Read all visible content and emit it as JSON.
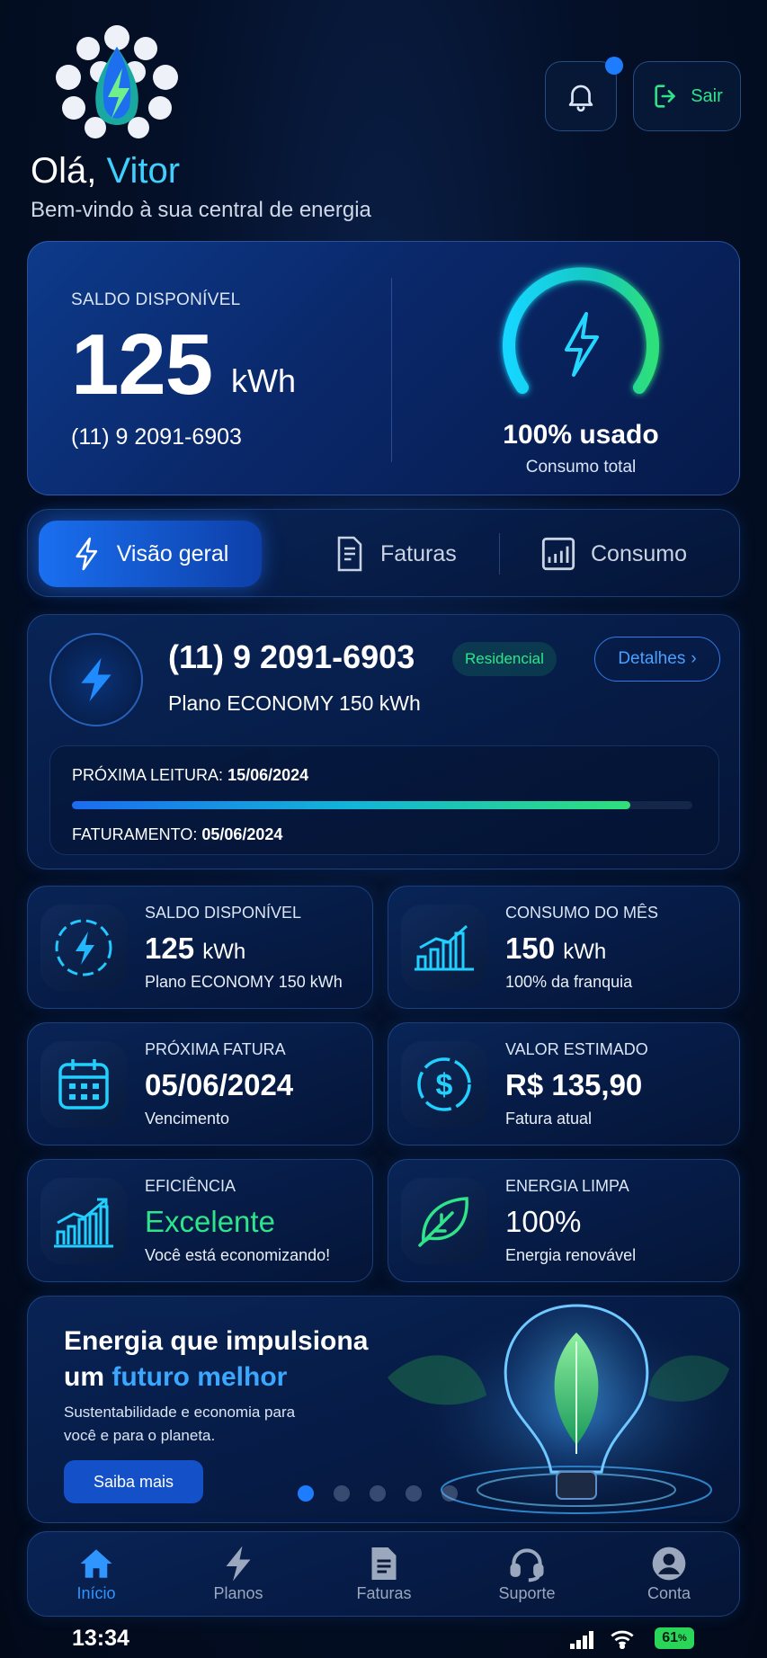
{
  "header": {
    "greeting": "Olá, ",
    "name": "Vitor",
    "welcome": "Bem-vindo à sua central de energia",
    "logout": "Sair",
    "notification_dot": true
  },
  "balance": {
    "label": "SALDO DISPONÍVEL",
    "value": "125",
    "unit": "kWh",
    "phone": "(11) 9 2091-6903",
    "usage_percent": 100,
    "usage_text": "100% usado",
    "usage_label": "Consumo total"
  },
  "tabs": [
    {
      "label": "Visão geral",
      "icon": "bolt-icon",
      "active": true
    },
    {
      "label": "Faturas",
      "icon": "invoice-icon"
    },
    {
      "label": "Consumo",
      "icon": "chart-icon"
    }
  ],
  "plan": {
    "phone": "(11) 9 2091-6903",
    "type": "Residencial",
    "details": "Detalhes",
    "name": "Plano ECONOMY 150 kWh",
    "next_reading_label": "PRÓXIMA LEITURA:",
    "next_reading": "15/06/2024",
    "billing_label": "FATURAMENTO:",
    "billing": "05/06/2024",
    "progress": 0.9
  },
  "stats": [
    {
      "title": "SALDO DISPONÍVEL",
      "value": "125",
      "unit": "kWh",
      "sub": "Plano ECONOMY 150 kWh",
      "icon": "bolt-circle-icon"
    },
    {
      "title": "CONSUMO DO MÊS",
      "value": "150",
      "unit": "kWh",
      "sub": "100% da franquia",
      "icon": "bar-chart-icon"
    },
    {
      "title": "PRÓXIMA FATURA",
      "value": "05/06/2024",
      "unit": "",
      "sub": "Vencimento",
      "icon": "calendar-icon"
    },
    {
      "title": "VALOR ESTIMADO",
      "value": "R$ 135,90",
      "unit": "",
      "sub": "Fatura atual",
      "icon": "dollar-icon"
    },
    {
      "title": "EFICIÊNCIA",
      "value": "Excelente",
      "unit": "",
      "sub": "Você está economizando!",
      "icon": "growth-chart-icon"
    },
    {
      "title": "ENERGIA LIMPA",
      "value": "100%",
      "unit": "",
      "sub": "Energia renovável",
      "icon": "leaf-icon"
    }
  ],
  "promo": {
    "line1": "Energia que impulsiona",
    "line2a": "um ",
    "line2b": "futuro melhor",
    "sub": "Sustentabilidade e economia para você e para o planeta.",
    "button": "Saiba mais",
    "active_dot": 0,
    "dot_count": 5
  },
  "nav": [
    {
      "label": "Início",
      "icon": "home-icon",
      "active": true
    },
    {
      "label": "Planos",
      "icon": "bolt-icon"
    },
    {
      "label": "Faturas",
      "icon": "invoice-icon"
    },
    {
      "label": "Suporte",
      "icon": "headset-icon"
    },
    {
      "label": "Conta",
      "icon": "user-icon"
    }
  ],
  "status_bar": {
    "time": "13:34",
    "battery": "61"
  },
  "colors": {
    "accent": "#1e7dff",
    "green": "#2ee58a",
    "cyan": "#3fd0ff"
  }
}
